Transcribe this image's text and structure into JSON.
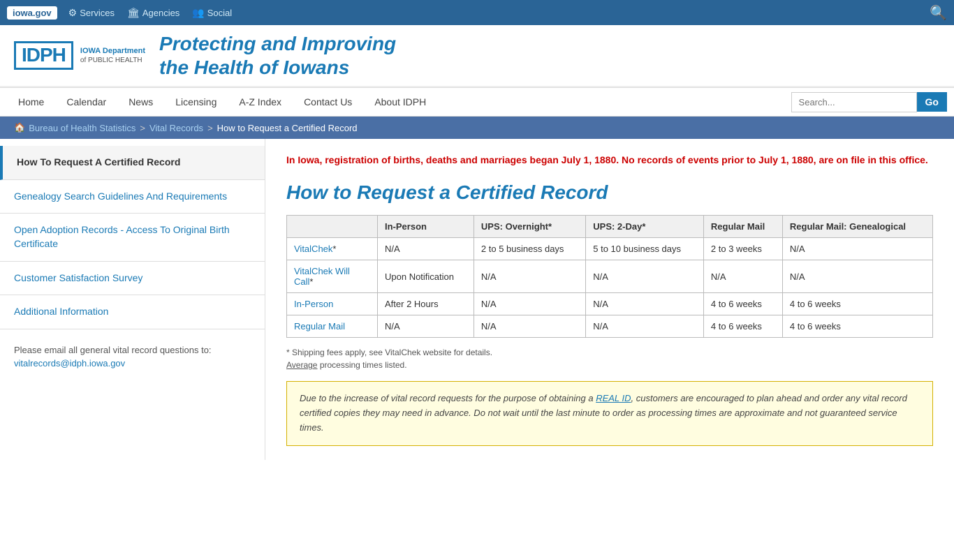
{
  "topbar": {
    "logo": "iowa.gov",
    "nav": [
      {
        "id": "services",
        "icon": "⚙",
        "label": "Services"
      },
      {
        "id": "agencies",
        "icon": "🏛",
        "label": "Agencies"
      },
      {
        "id": "social",
        "icon": "👥",
        "label": "Social"
      }
    ]
  },
  "header": {
    "logo_text": "IDPH",
    "logo_sub1": "IOWA Department",
    "logo_sub2": "of PUBLIC HEALTH",
    "tagline_line1": "Protecting and Improving",
    "tagline_line2": "the Health of Iowans"
  },
  "mainnav": {
    "items": [
      {
        "id": "home",
        "label": "Home"
      },
      {
        "id": "calendar",
        "label": "Calendar"
      },
      {
        "id": "news",
        "label": "News"
      },
      {
        "id": "licensing",
        "label": "Licensing"
      },
      {
        "id": "az-index",
        "label": "A-Z Index"
      },
      {
        "id": "contact-us",
        "label": "Contact Us"
      },
      {
        "id": "about-idph",
        "label": "About IDPH"
      }
    ],
    "search_placeholder": "Search...",
    "search_button": "Go"
  },
  "breadcrumb": {
    "home_icon": "🏠",
    "crumbs": [
      {
        "id": "bureau",
        "label": "Bureau of Health Statistics"
      },
      {
        "id": "vital",
        "label": "Vital Records"
      },
      {
        "id": "current",
        "label": "How to Request a Certified Record"
      }
    ]
  },
  "sidebar": {
    "items": [
      {
        "id": "how-to-request",
        "label": "How To Request A Certified Record",
        "active": true
      },
      {
        "id": "genealogy",
        "label": "Genealogy Search Guidelines And Requirements"
      },
      {
        "id": "open-adoption",
        "label": "Open Adoption Records - Access To Original Birth Certificate"
      },
      {
        "id": "survey",
        "label": "Customer Satisfaction Survey"
      },
      {
        "id": "additional",
        "label": "Additional Information"
      }
    ],
    "email_intro": "Please email all general vital record questions to:",
    "email_link": "vitalrecords@idph.iowa.gov"
  },
  "content": {
    "alert": "In Iowa, registration of births, deaths and marriages began July 1, 1880. No records of events prior to July 1, 1880, are on file in this office.",
    "page_title": "How to Request a Certified Record",
    "table": {
      "headers": [
        "",
        "In-Person",
        "UPS: Overnight*",
        "UPS: 2-Day*",
        "Regular Mail",
        "Regular Mail: Genealogical"
      ],
      "rows": [
        {
          "method_link": "VitalChek",
          "method_suffix": "*",
          "in_person": "N/A",
          "ups_overnight": "2 to 5 business days",
          "ups_2day": "5 to 10 business days",
          "regular_mail": "2 to 3 weeks",
          "genealogical": "N/A"
        },
        {
          "method_link": "VitalChek Will Call",
          "method_suffix": "*",
          "in_person": "Upon Notification",
          "ups_overnight": "N/A",
          "ups_2day": "N/A",
          "regular_mail": "N/A",
          "genealogical": "N/A"
        },
        {
          "method_link": "In-Person",
          "method_suffix": "",
          "in_person": "After 2 Hours",
          "ups_overnight": "N/A",
          "ups_2day": "N/A",
          "regular_mail": "4 to 6 weeks",
          "genealogical": "4 to 6 weeks"
        },
        {
          "method_link": "Regular Mail",
          "method_suffix": "",
          "in_person": "N/A",
          "ups_overnight": "N/A",
          "ups_2day": "N/A",
          "regular_mail": "4 to 6 weeks",
          "genealogical": "4 to 6 weeks"
        }
      ],
      "note1": "* Shipping fees apply, see VitalChek website for details.",
      "note2_prefix": "",
      "note2_underline": "Average",
      "note2_suffix": " processing times listed."
    },
    "notice": {
      "text_before_link": "Due to the increase of vital record requests for the purpose of obtaining a ",
      "link_text": "REAL ID",
      "text_after_link": ", customers are encouraged to plan ahead and order any vital record certified copies they may need in advance. Do not wait until the last minute to order as processing times are approximate and not guaranteed service times."
    }
  }
}
